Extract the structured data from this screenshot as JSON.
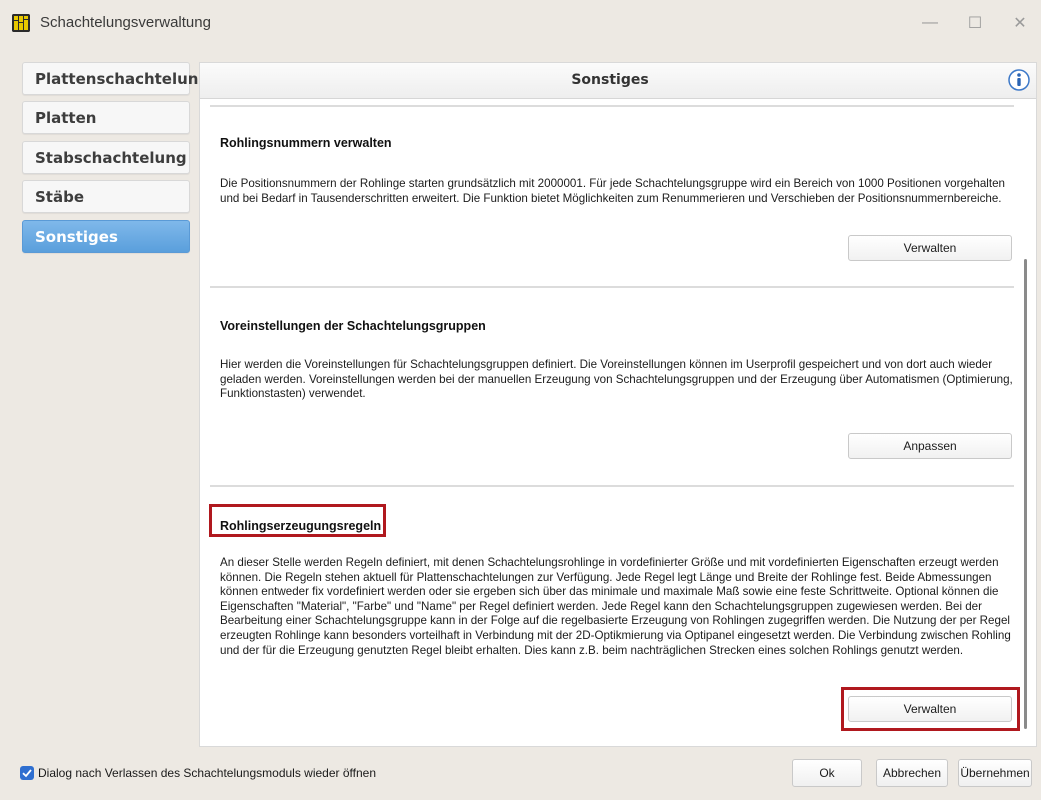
{
  "window": {
    "title": "Schachtelungsverwaltung",
    "minimize": "—",
    "maximize": "☐",
    "close": "✕"
  },
  "sidebar": {
    "items": [
      {
        "label": "Plattenschachtelung",
        "active": false
      },
      {
        "label": "Platten",
        "active": false
      },
      {
        "label": "Stabschachtelung",
        "active": false
      },
      {
        "label": "Stäbe",
        "active": false
      },
      {
        "label": "Sonstiges",
        "active": true
      }
    ]
  },
  "panel": {
    "title": "Sonstiges",
    "sections": [
      {
        "title": "Rohlingsnummern verwalten",
        "text": "Die Positionsnummern der Rohlinge starten grundsätzlich mit 2000001. Für jede Schachtelungsgruppe wird ein Bereich von 1000 Positionen vorgehalten und bei Bedarf in Tausenderschritten erweitert. Die Funktion bietet Möglichkeiten zum Renummerieren und Verschieben der Positionsnummernbereiche.",
        "button": "Verwalten"
      },
      {
        "title": "Voreinstellungen der Schachtelungsgruppen",
        "text": "Hier werden die Voreinstellungen für Schachtelungsgruppen definiert. Die Voreinstellungen können im Userprofil gespeichert und von dort  auch wieder geladen werden. Voreinstellungen werden bei der manuellen Erzeugung von Schachtelungsgruppen und der Erzeugung über Automatismen (Optimierung, Funktionstasten) verwendet.",
        "button": "Anpassen"
      },
      {
        "title": "Rohlingserzeugungsregeln",
        "text": "An dieser Stelle werden Regeln definiert, mit denen Schachtelungsrohlinge in vordefinierter Größe und mit vordefinierten Eigenschaften erzeugt werden können. Die Regeln stehen aktuell für Plattenschachtelungen zur Verfügung. Jede Regel legt Länge und Breite der Rohlinge fest. Beide Abmessungen können entweder fix vordefiniert werden oder sie ergeben sich über das minimale und maximale Maß sowie eine feste Schrittweite. Optional können die Eigenschaften \"Material\", \"Farbe\" und \"Name\" per Regel definiert werden. Jede Regel kann den Schachtelungsgruppen zugewiesen werden. Bei der Bearbeitung einer Schachtelungsgruppe kann in der Folge auf die regelbasierte Erzeugung von Rohlingen zugegriffen werden. Die Nutzung der per Regel erzeugten Rohlinge kann besonders vorteilhaft in Verbindung mit der 2D-Optikmierung via Optipanel eingesetzt werden. Die Verbindung zwischen Rohling und der für die Erzeugung genutzten Regel bleibt erhalten. Dies kann z.B. beim nachträglichen Strecken eines solchen Rohlings genutzt werden.",
        "button": "Verwalten"
      }
    ]
  },
  "footer": {
    "checkbox_label": "Dialog nach Verlassen des Schachtelungsmoduls wieder öffnen",
    "checkbox_checked": true,
    "ok": "Ok",
    "cancel": "Abbrechen",
    "apply": "Übernehmen"
  },
  "colors": {
    "accent": "#5a9fdc",
    "highlight": "#b0181e",
    "checkbox": "#2f6fd0"
  },
  "icons": {
    "app": "app-grid-icon",
    "info": "info-icon",
    "check": "check-icon"
  }
}
